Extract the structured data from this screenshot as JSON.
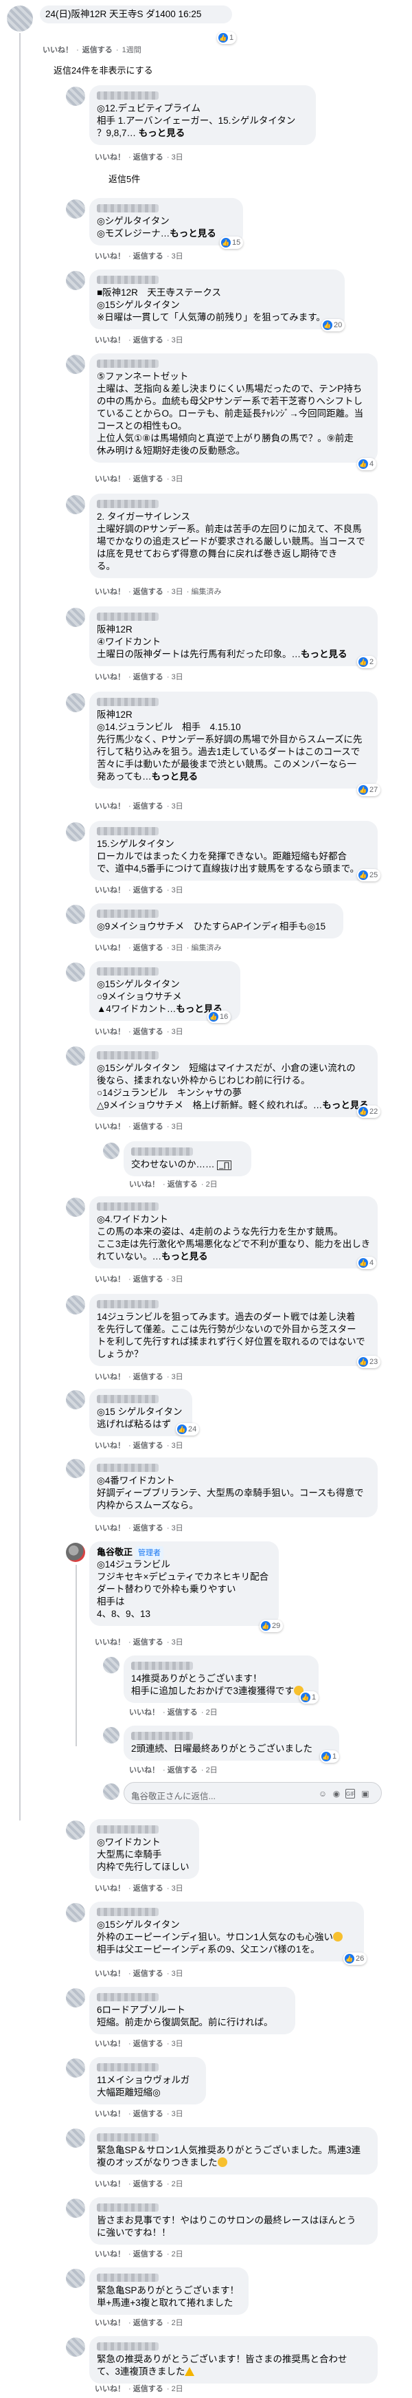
{
  "comments": [
    {
      "id": "c0",
      "lines": [
        "24(日)阪神12R 天王寺S ダ1400 16:25"
      ],
      "meta": {
        "like": "いいね！",
        "reply": "返信する",
        "time": "1週間"
      },
      "react": "1",
      "hide_replies": "返信24件を非表示にする"
    },
    {
      "id": "c1",
      "lines": [
        "◎12.デュビティプライム",
        "相手 1.アーバンイェーガー、15.シゲルタイタン",
        "？9,8,7…"
      ],
      "more": "もっと見る",
      "meta": {
        "like": "いいね！",
        "reply": "返信する",
        "time": "3日"
      },
      "replies_label": "返信5件"
    },
    {
      "id": "c2",
      "lines": [
        "◎シゲルタイタン",
        "◎モズレジーナ…"
      ],
      "more": "もっと見る",
      "meta": {
        "like": "いいね！",
        "reply": "返信する",
        "time": "3日"
      },
      "react": "15"
    },
    {
      "id": "c3",
      "lines": [
        "■阪神12R　天王寺ステークス",
        "◎15シゲルタイタン",
        "※日曜は一貫して「人気薄の前残り」を狙ってみます。"
      ],
      "meta": {
        "like": "いいね！",
        "reply": "返信する",
        "time": "3日"
      },
      "react": "20"
    },
    {
      "id": "c4",
      "lines": [
        "⑤ファンネートゼット",
        "土曜は、芝指向＆差し決まりにくい馬場だったので、テンP持ち",
        "の中の馬から。血統も母父Pサンデー系で若干芝寄りへシフトし",
        "ていることからO。ローテも、前走延長ﾁｬﾚﾝｼﾞ→今回同距離。当",
        "コースとの相性もO。",
        "上位人気①⑧は馬場傾向と真逆で上がり勝負の馬で？。⑨前走",
        "休み明け＆短期好走後の反動懸念。"
      ],
      "meta": {
        "like": "いいね！",
        "reply": "返信する",
        "time": "3日"
      },
      "react": "4"
    },
    {
      "id": "c5",
      "lines": [
        "2. タイガーサイレンス",
        "土曜好調のPサンデー系。前走は苦手の左回りに加えて、不良馬",
        "場でかなりの追走スピードが要求される厳しい競馬。当コースで",
        "は底を見せておらず得意の舞台に戻れば巻き返し期待でき",
        "る。"
      ],
      "meta": {
        "like": "いいね！",
        "reply": "返信する",
        "time": "3日",
        "edited": "編集済み"
      }
    },
    {
      "id": "c6",
      "lines": [
        "阪神12R",
        "④ワイドカント",
        "土曜日の阪神ダートは先行馬有利だった印象。…"
      ],
      "more": "もっと見る",
      "meta": {
        "like": "いいね！",
        "reply": "返信する",
        "time": "3日"
      },
      "react": "2"
    },
    {
      "id": "c7",
      "lines": [
        "阪神12R",
        "◎14.ジュランビル　相手　4.15.10",
        "先行馬少なく、Pサンデー系好調の馬場で外目からスムーズに先",
        "行して粘り込みを狙う。過去1走しているダートはこのコースで",
        "苦々に手は動いたが最後まで渋とい競馬。このメンバーなら一",
        "発あっても…"
      ],
      "more": "もっと見る",
      "meta": {
        "like": "いいね！",
        "reply": "返信する",
        "time": "3日"
      },
      "react": "27"
    },
    {
      "id": "c8",
      "lines": [
        "15.シゲルタイタン",
        "ローカルではまったく力を発揮できない。距離短縮も好都合",
        "で、道中4,5番手につけて直線抜け出す競馬をするなら頭まで。"
      ],
      "meta": {
        "like": "いいね！",
        "reply": "返信する",
        "time": "3日"
      },
      "react": "25"
    },
    {
      "id": "c9",
      "lines": [
        "◎9メイショウサチメ　ひたすらAPインディ相手も◎15"
      ],
      "meta": {
        "like": "いいね！",
        "reply": "返信する",
        "time": "3日",
        "edited": "編集済み"
      }
    },
    {
      "id": "c10",
      "lines": [
        "◎15シゲルタイタン",
        "○9メイショウサチメ",
        "▲4ワイドカント…"
      ],
      "more": "もっと見る",
      "meta": {
        "like": "いいね！",
        "reply": "返信する",
        "time": "3日"
      },
      "react": "16"
    },
    {
      "id": "c11",
      "lines": [
        "◎15シゲルタイタン　短縮はマイナスだが、小倉の速い流れの",
        "後なら、揉まれない外枠からじわじわ前に行ける。",
        "○14ジュランビル　キンシャサの夢",
        "△9メイショウサチメ　格上げ新鮮。軽く絞れれば。…"
      ],
      "more": "もっと見る",
      "meta": {
        "like": "いいね！",
        "reply": "返信する",
        "time": "3日"
      },
      "react": "22"
    },
    {
      "id": "c12",
      "lines": [
        "交わせないのか……"
      ],
      "meta": {
        "like": "いいね！",
        "reply": "返信する",
        "time": "2日"
      }
    },
    {
      "id": "c13",
      "lines": [
        "◎4.ワイドカント",
        "この馬の本来の姿は、4走前のような先行力を生かす競馬。",
        "ここ3走は先行激化や馬場悪化などで不利が重なり、能力を出しき",
        "れていない。…"
      ],
      "more": "もっと見る",
      "meta": {
        "like": "いいね！",
        "reply": "返信する",
        "time": "3日"
      },
      "react": "4"
    },
    {
      "id": "c14",
      "lines": [
        "14ジュランビルを狙ってみます。過去のダート戦では差し決着",
        "を先行して僅差。ここは先行勢が少ないので外目から芝スター",
        "トを利して先行すれば揉まれず行く好位置を取れるのではないで",
        "しょうか？"
      ],
      "meta": {
        "like": "いいね！",
        "reply": "返信する",
        "time": "3日"
      },
      "react": "23"
    },
    {
      "id": "c15",
      "lines": [
        "◎15 シゲルタイタン",
        "逃げれば粘るはず"
      ],
      "meta": {
        "like": "いいね！",
        "reply": "返信する",
        "time": "3日"
      },
      "react": "24"
    },
    {
      "id": "c16",
      "lines": [
        "◎4番ワイドカント",
        "好調ディープブリランテ、大型馬の幸騎手狙い。コースも得意で",
        "内枠からスムーズなら。"
      ],
      "meta": {
        "like": "いいね！",
        "reply": "返信する",
        "time": "3日"
      }
    },
    {
      "id": "c17",
      "author": "亀谷敬正",
      "badge": "管理者",
      "lines": [
        "◎14ジュランビル",
        "フジキセキ×デピュティでカネヒキリ配合",
        "ダート替わりで外枠も乗りやすい",
        "相手は",
        "4、8、9、13"
      ],
      "meta": {
        "like": "いいね！",
        "reply": "返信する",
        "time": "3日"
      },
      "react": "29"
    },
    {
      "id": "c18",
      "lines": [
        "14推奨ありがとうございます！",
        "相手に追加したおかげで3連複獲得です"
      ],
      "meta": {
        "like": "いいね！",
        "reply": "返信する",
        "time": "2日"
      },
      "react": "1"
    },
    {
      "id": "c19",
      "lines": [
        "2頭連続、日曜最終ありがとうございました"
      ],
      "meta": {
        "like": "いいね！",
        "reply": "返信する",
        "time": "2日"
      },
      "react": "1"
    },
    {
      "id": "c20",
      "lines": [
        "◎ワイドカント",
        "大型馬に幸騎手",
        "内枠で先行してほしい"
      ],
      "meta": {
        "like": "いいね！",
        "reply": "返信する",
        "time": "3日"
      }
    },
    {
      "id": "c21",
      "lines": [
        "◎15シゲルタイタン",
        "外枠のエーピーインディ狙い。サロン1人気なのも心強い",
        "相手は父エーピーインディ系の9、父エンパ様の1を。"
      ],
      "meta": {
        "like": "いいね！",
        "reply": "返信する",
        "time": "3日"
      },
      "react": "26"
    },
    {
      "id": "c22",
      "lines": [
        "6ロードアブソルート",
        "短縮。前走から復調気配。前に行ければ。"
      ],
      "meta": {
        "like": "いいね！",
        "reply": "返信する",
        "time": "3日"
      }
    },
    {
      "id": "c23",
      "lines": [
        "11メイショウヴォルガ",
        "大幅距離短縮◎"
      ],
      "meta": {
        "like": "いいね！",
        "reply": "返信する",
        "time": "3日"
      }
    },
    {
      "id": "c24",
      "lines": [
        "緊急亀SP＆サロン1人気推奨ありがとうございました。馬連3連",
        "複のオッズがなりつきました"
      ],
      "meta": {
        "like": "いいね！",
        "reply": "返信する",
        "time": "2日"
      }
    },
    {
      "id": "c25",
      "lines": [
        "皆さまお見事です！やはりこのサロンの最終レースはほんとう",
        "に強いですね！！"
      ],
      "meta": {
        "like": "いいね！",
        "reply": "返信する",
        "time": "2日"
      }
    },
    {
      "id": "c26",
      "lines": [
        "緊急亀SPありがとうございます！",
        "単+馬連+3複と取れて捲れました"
      ],
      "meta": {
        "like": "いいね！",
        "reply": "返信する",
        "time": "2日"
      }
    },
    {
      "id": "c27",
      "lines": [
        "緊急の推奨ありがとうございます！皆さまの推奨馬と合わせ",
        "て、3連複頂きました"
      ],
      "meta": {
        "like": "いいね！",
        "reply": "返信する",
        "time": "2日"
      }
    }
  ],
  "reply_box": {
    "placeholder": "亀谷敬正さんに返信..."
  }
}
